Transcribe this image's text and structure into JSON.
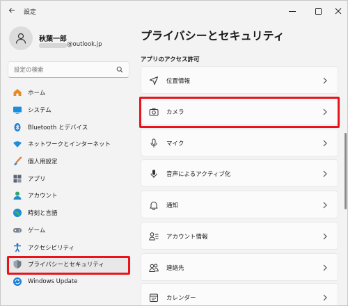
{
  "window": {
    "title": "設定"
  },
  "profile": {
    "name": "秋葉一郎",
    "email_suffix": "@outlook.jp"
  },
  "search": {
    "placeholder": "設定の検索"
  },
  "sidebar": {
    "items": [
      {
        "label": "ホーム",
        "icon": "home-icon"
      },
      {
        "label": "システム",
        "icon": "system-icon"
      },
      {
        "label": "Bluetooth とデバイス",
        "icon": "bluetooth-icon"
      },
      {
        "label": "ネットワークとインターネット",
        "icon": "network-icon"
      },
      {
        "label": "個人用設定",
        "icon": "brush-icon"
      },
      {
        "label": "アプリ",
        "icon": "apps-icon"
      },
      {
        "label": "アカウント",
        "icon": "account-icon"
      },
      {
        "label": "時刻と言語",
        "icon": "globe-icon"
      },
      {
        "label": "ゲーム",
        "icon": "gamepad-icon"
      },
      {
        "label": "アクセシビリティ",
        "icon": "accessibility-icon"
      },
      {
        "label": "プライバシーとセキュリティ",
        "icon": "shield-icon",
        "selected": true
      },
      {
        "label": "Windows Update",
        "icon": "update-icon"
      }
    ]
  },
  "main": {
    "title": "プライバシーとセキュリティ",
    "section": "アプリのアクセス許可",
    "items": [
      {
        "label": "位置情報",
        "icon": "location-icon"
      },
      {
        "label": "カメラ",
        "icon": "camera-icon"
      },
      {
        "label": "マイク",
        "icon": "microphone-icon"
      },
      {
        "label": "音声によるアクティブ化",
        "icon": "voice-activation-icon"
      },
      {
        "label": "通知",
        "icon": "bell-icon"
      },
      {
        "label": "アカウント情報",
        "icon": "account-info-icon"
      },
      {
        "label": "連絡先",
        "icon": "contacts-icon"
      },
      {
        "label": "カレンダー",
        "icon": "calendar-icon"
      }
    ]
  },
  "colors": {
    "accent": "#0067c0",
    "highlight": "#e8141c",
    "background": "#f3f3f3",
    "card": "#fbfbfb"
  }
}
